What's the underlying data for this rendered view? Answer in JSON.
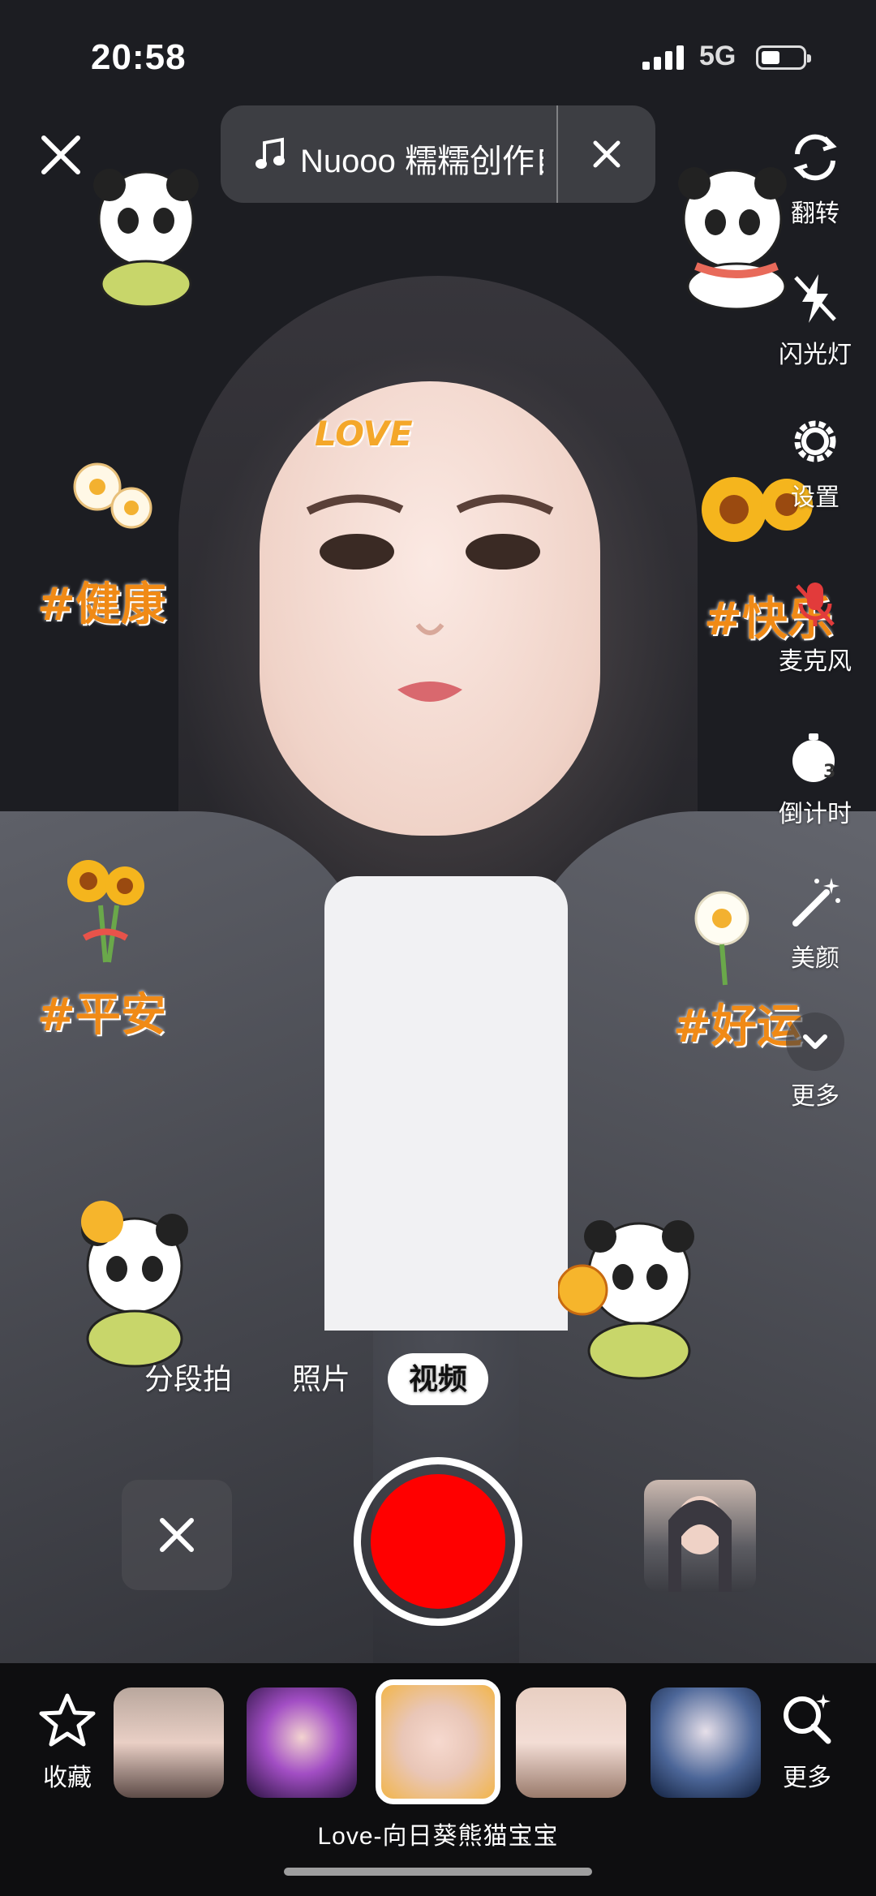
{
  "status_bar": {
    "time": "20:58",
    "network": "5G"
  },
  "music": {
    "title": "Nuooo 糯糯创作自"
  },
  "right_toolbar": [
    {
      "label": "翻转",
      "icon": "flip-camera-icon"
    },
    {
      "label": "闪光灯",
      "icon": "flash-off-icon"
    },
    {
      "label": "设置",
      "icon": "gear-icon"
    },
    {
      "label": "麦克风",
      "icon": "microphone-off-icon"
    },
    {
      "label": "倒计时",
      "icon": "timer-icon"
    },
    {
      "label": "美颜",
      "icon": "magic-wand-icon"
    },
    {
      "label": "更多",
      "icon": "chevron-down-icon"
    }
  ],
  "stickers": {
    "tag1": "#健康",
    "tag2": "#快乐",
    "tag3": "#平安",
    "tag4": "#好运",
    "love": "LOVE"
  },
  "modes": {
    "segment": "分段拍",
    "photo": "照片",
    "video": "视频",
    "active": "视频"
  },
  "bottom_bar": {
    "favorites_label": "收藏",
    "more_label": "更多",
    "selected_effect": "Love-向日葵熊猫宝宝"
  },
  "colors": {
    "shutter": "#ff0000",
    "sticker_text": "#f08a16",
    "bottom_bg": "#0e0e10"
  }
}
